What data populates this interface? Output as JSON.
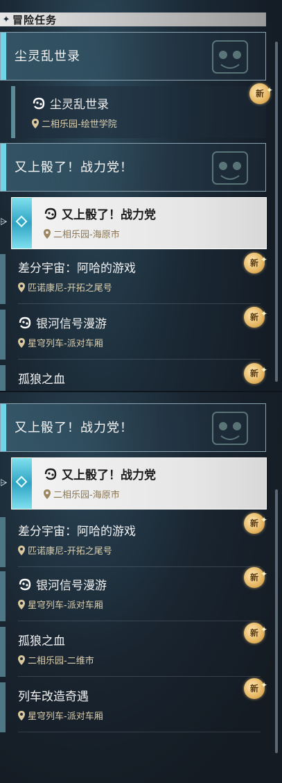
{
  "header": {
    "title": "冒险任务"
  },
  "top": {
    "chapter_1": {
      "title": "尘灵乱世录"
    },
    "sub_1": {
      "name": "尘灵乱世录",
      "location": "二相乐园-绘世学院",
      "badge": "新"
    },
    "chapter_2": {
      "title": "又上骰了！战力党！"
    },
    "active": {
      "name": "又上骰了！战力党",
      "location": "二相乐园-海原市"
    },
    "items": [
      {
        "name": "差分宇宙：阿哈的游戏",
        "location": "匹诺康尼-开拓之尾号",
        "badge": "新",
        "has_icon": false
      },
      {
        "name": "银河信号漫游",
        "location": "星穹列车-派对车厢",
        "badge": "新",
        "has_icon": true
      },
      {
        "name": "孤狼之血",
        "location": "",
        "badge": "新",
        "has_icon": false
      }
    ]
  },
  "bottom": {
    "chapter": {
      "title": "又上骰了！战力党！"
    },
    "active": {
      "name": "又上骰了！战力党",
      "location": "二相乐园-海原市"
    },
    "items": [
      {
        "name": "差分宇宙：阿哈的游戏",
        "location": "匹诺康尼-开拓之尾号",
        "badge": "新",
        "has_icon": false
      },
      {
        "name": "银河信号漫游",
        "location": "星穹列车-派对车厢",
        "badge": "新",
        "has_icon": true
      },
      {
        "name": "孤狼之血",
        "location": "二相乐园-二维市",
        "badge": "新",
        "has_icon": false
      },
      {
        "name": "列车改造奇遇",
        "location": "星穹列车-派对车厢",
        "badge": "新",
        "has_icon": false
      }
    ]
  },
  "colors": {
    "accent": "#6fd4e6",
    "location_text": "#ddd0b0",
    "badge": "#e5b560"
  }
}
